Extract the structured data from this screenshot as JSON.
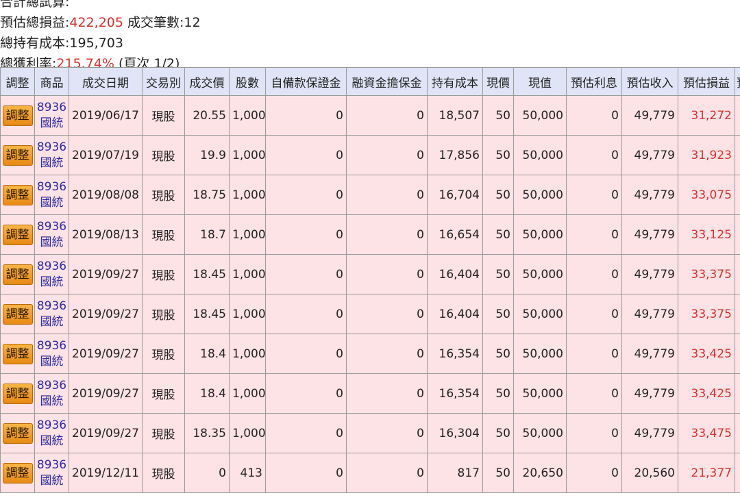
{
  "summary": {
    "header_partial": "合計總試算:",
    "est_total_pnl_label": "預估總損益:",
    "est_total_pnl_value": "422,205",
    "trade_count_label": " 成交筆數:12",
    "total_cost_line": "總持有成本:195,703",
    "total_return_label": "總獲利率:",
    "total_return_value": "215.74%",
    "page_info": " (頁次 1/2)"
  },
  "table": {
    "headers": [
      "調整",
      "商品",
      "成交日期",
      "交易別",
      "成交價",
      "股數",
      "自備款保證金",
      "融資金擔保金",
      "持有成本",
      "現價",
      "現值",
      "預估利息",
      "預估收入",
      "預估損益",
      "預"
    ],
    "rows": [
      {
        "adjust": "調整",
        "code": "8936",
        "name": "國統",
        "date": "2019/06/17",
        "type": "現股",
        "price": "20.55",
        "shares": "1,000",
        "own": "0",
        "margin": "0",
        "cost": "18,507",
        "cur_price": "50",
        "cur_value": "50,000",
        "interest": "0",
        "income": "49,779",
        "pnl": "31,272"
      },
      {
        "adjust": "調整",
        "code": "8936",
        "name": "國統",
        "date": "2019/07/19",
        "type": "現股",
        "price": "19.9",
        "shares": "1,000",
        "own": "0",
        "margin": "0",
        "cost": "17,856",
        "cur_price": "50",
        "cur_value": "50,000",
        "interest": "0",
        "income": "49,779",
        "pnl": "31,923"
      },
      {
        "adjust": "調整",
        "code": "8936",
        "name": "國統",
        "date": "2019/08/08",
        "type": "現股",
        "price": "18.75",
        "shares": "1,000",
        "own": "0",
        "margin": "0",
        "cost": "16,704",
        "cur_price": "50",
        "cur_value": "50,000",
        "interest": "0",
        "income": "49,779",
        "pnl": "33,075"
      },
      {
        "adjust": "調整",
        "code": "8936",
        "name": "國統",
        "date": "2019/08/13",
        "type": "現股",
        "price": "18.7",
        "shares": "1,000",
        "own": "0",
        "margin": "0",
        "cost": "16,654",
        "cur_price": "50",
        "cur_value": "50,000",
        "interest": "0",
        "income": "49,779",
        "pnl": "33,125"
      },
      {
        "adjust": "調整",
        "code": "8936",
        "name": "國統",
        "date": "2019/09/27",
        "type": "現股",
        "price": "18.45",
        "shares": "1,000",
        "own": "0",
        "margin": "0",
        "cost": "16,404",
        "cur_price": "50",
        "cur_value": "50,000",
        "interest": "0",
        "income": "49,779",
        "pnl": "33,375"
      },
      {
        "adjust": "調整",
        "code": "8936",
        "name": "國統",
        "date": "2019/09/27",
        "type": "現股",
        "price": "18.45",
        "shares": "1,000",
        "own": "0",
        "margin": "0",
        "cost": "16,404",
        "cur_price": "50",
        "cur_value": "50,000",
        "interest": "0",
        "income": "49,779",
        "pnl": "33,375"
      },
      {
        "adjust": "調整",
        "code": "8936",
        "name": "國統",
        "date": "2019/09/27",
        "type": "現股",
        "price": "18.4",
        "shares": "1,000",
        "own": "0",
        "margin": "0",
        "cost": "16,354",
        "cur_price": "50",
        "cur_value": "50,000",
        "interest": "0",
        "income": "49,779",
        "pnl": "33,425"
      },
      {
        "adjust": "調整",
        "code": "8936",
        "name": "國統",
        "date": "2019/09/27",
        "type": "現股",
        "price": "18.4",
        "shares": "1,000",
        "own": "0",
        "margin": "0",
        "cost": "16,354",
        "cur_price": "50",
        "cur_value": "50,000",
        "interest": "0",
        "income": "49,779",
        "pnl": "33,425"
      },
      {
        "adjust": "調整",
        "code": "8936",
        "name": "國統",
        "date": "2019/09/27",
        "type": "現股",
        "price": "18.35",
        "shares": "1,000",
        "own": "0",
        "margin": "0",
        "cost": "16,304",
        "cur_price": "50",
        "cur_value": "50,000",
        "interest": "0",
        "income": "49,779",
        "pnl": "33,475"
      },
      {
        "adjust": "調整",
        "code": "8936",
        "name": "國統",
        "date": "2019/12/11",
        "type": "現股",
        "price": "0",
        "shares": "413",
        "own": "0",
        "margin": "0",
        "cost": "817",
        "cur_price": "50",
        "cur_value": "20,650",
        "interest": "0",
        "income": "20,560",
        "pnl": "21,377"
      }
    ]
  },
  "colors": {
    "header_bg": "#dfe5f6",
    "row_bg": "#fde2e6",
    "loss_text": "#d9302b",
    "link_text": "#2b2ba6",
    "button_orange": "#f0a030"
  }
}
